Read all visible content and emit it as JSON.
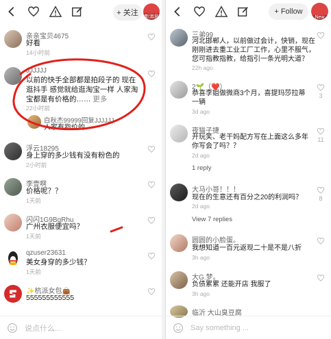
{
  "left": {
    "follow_label": "+ 关注",
    "avatar_badge": "新消息",
    "comments": [
      {
        "name": "亲亲宝贝4675",
        "text": "好看",
        "time": "14小时前",
        "likes": ""
      },
      {
        "name": "JJJJJJ",
        "text": "以前的快手全部都是拍段子的   现在逛抖手  感觉就给逛淘宝一样      人家淘宝都是有价格的……",
        "more": "更多",
        "time": "22小时前",
        "likes": "",
        "reply_name": "白秋杰99999回复JJJJJJ",
        "reply_text": "人家有指价的"
      },
      {
        "name": "浮云18295",
        "text": "身上穿的多少钱有没有粉色的",
        "time": "2小时前",
        "likes": ""
      },
      {
        "name": "李壹啊",
        "text": "价格呢？？",
        "time": "1天前",
        "likes": ""
      },
      {
        "name": "闪闪1G9BgRhu",
        "text": "广州衣服便宜吗？",
        "time": "1天前",
        "likes": ""
      },
      {
        "name": "qzuser23631",
        "text": "美女身穿的多少钱？",
        "time": "1天前",
        "likes": ""
      },
      {
        "name": "✨杭派女包👜",
        "text": "555555555555",
        "time": "",
        "likes": ""
      }
    ],
    "input_placeholder": "说点什么..."
  },
  "right": {
    "follow_label": "+ Follow",
    "avatar_badge": "New",
    "comments": [
      {
        "name": "三弟99",
        "text": "河北邯郸人，以前做过会计，快销，现在刚刚进去重工业工厂工作，心里不服气，您可指教指教，给指引一条光明大道？",
        "time": "22h ago",
        "likes": ""
      },
      {
        "name": "2🌱（❤️）",
        "text": "恭喜李姐做微商3个月，喜提玛莎拉蒂一辆",
        "time": "3d ago",
        "likes": "3"
      },
      {
        "name": "夜猫子捷",
        "text": "开玩笑、老干妈配方写在上面这么多年你写会了吗？？",
        "time": "2d ago",
        "likes": "11",
        "replies": "1 reply"
      },
      {
        "name": "大马小哥！！！",
        "text": "现在的生意还有百分之20的利润吗？",
        "time": "2d ago",
        "likes": "8",
        "replies": "View 7 replies"
      },
      {
        "name": "圆圆的小脸蛋。",
        "text": "我想知道一百元返现二十是不是八折",
        "time": "3h ago",
        "likes": ""
      },
      {
        "name": "大G.梦。",
        "text": "负债累累 还能开店 我服了",
        "time": "3h ago",
        "likes": ""
      },
      {
        "name": "临沂 大山臭豆腐",
        "text": "",
        "time": "",
        "likes": ""
      }
    ],
    "input_placeholder": "Say something ..."
  },
  "colors": {
    "annotation_red": "#e0201a",
    "avatar_red": "#d63b3b"
  }
}
